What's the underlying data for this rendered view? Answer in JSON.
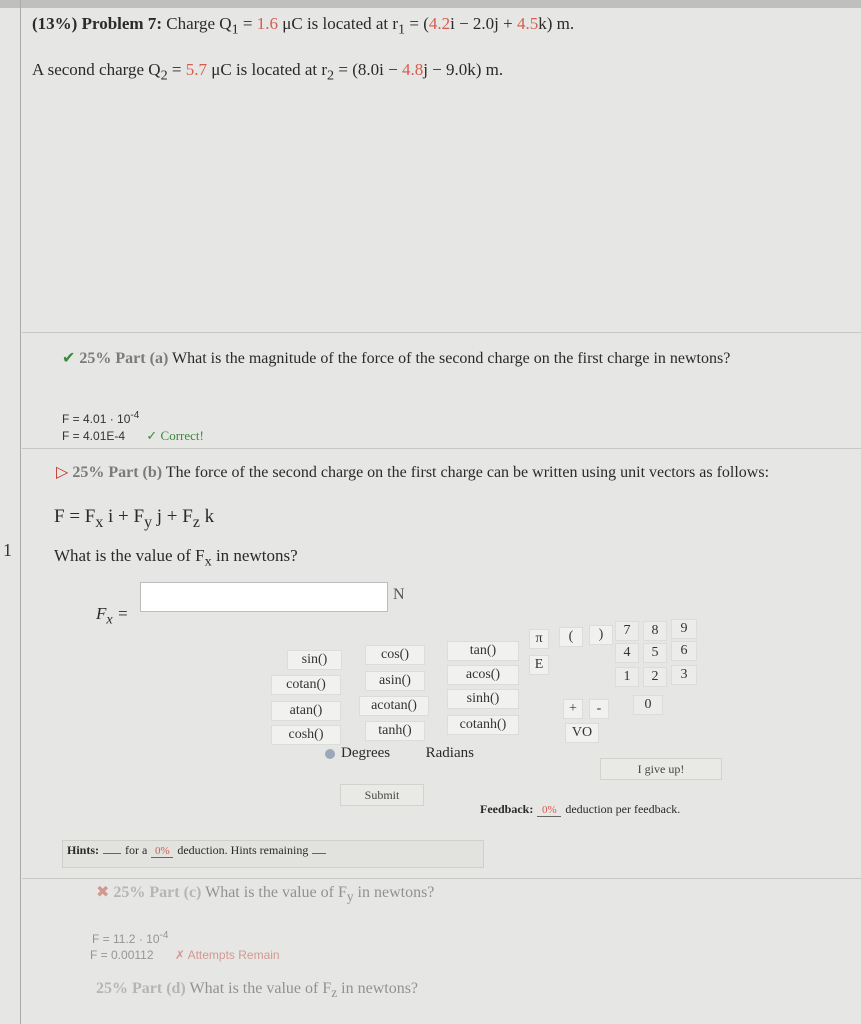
{
  "problem": {
    "weight": "(13%)",
    "title": "Problem 7:",
    "q1_text": "Charge Q",
    "q1_sub": "1",
    "q1_eq": " = ",
    "q1_value": "1.6",
    "q1_unit": " μC is located at r",
    "r1_sub": "1",
    "r1_open": " = (",
    "r1_x": "4.2",
    "r1_mid1": "i − 2.0j + ",
    "r1_z": "4.5",
    "r1_close": "k) m.",
    "q2_text": "A second charge Q",
    "q2_sub": "2",
    "q2_eq": " = ",
    "q2_value": "5.7",
    "q2_unit": " μC is located at r",
    "r2_sub": "2",
    "r2_open": " = (8.0i − ",
    "r2_y": "4.8",
    "r2_close": "j − 9.0k) m."
  },
  "part_a": {
    "tag": "25% Part (a)",
    "question": "What is the magnitude of the force of the second charge on the first charge in newtons?",
    "answer_sci_prefix": "F = 4.01 · 10",
    "answer_sci_exp": "-4",
    "answer_entered": "F = 4.01E-4",
    "status": "✓ Correct!"
  },
  "part_b": {
    "tag": "25% Part (b)",
    "question": "The force of the second charge on the first charge can be written using unit vectors as follows:",
    "formula": "F = F",
    "formula_x": "x",
    "formula_mid1": " i + F",
    "formula_y": "y",
    "formula_mid2": " j + F",
    "formula_z": "z",
    "formula_end": " k",
    "subquestion": "What is the value of F",
    "subquestion_sub": "x",
    "subquestion_end": " in newtons?",
    "input_label": "F",
    "input_label_sub": "x",
    "input_label_eq": " =",
    "input_value": "",
    "unit": "N"
  },
  "calculator": {
    "functions": [
      [
        "sin()",
        "cos()",
        "tan()"
      ],
      [
        "cotan()",
        "asin()",
        "acos()"
      ],
      [
        "atan()",
        "acotan()",
        "sinh()"
      ],
      [
        "cosh()",
        "tanh()",
        "cotanh()"
      ]
    ],
    "pi": "π",
    "open_paren": "(",
    "close_paren": ")",
    "e": "E",
    "plus": "+",
    "minus": "-",
    "numpad": [
      "7",
      "8",
      "9",
      "4",
      "5",
      "6",
      "1",
      "2",
      "3",
      "0"
    ],
    "backspace": "VO",
    "degrees": "Degrees",
    "radians": "Radians"
  },
  "actions": {
    "submit": "Submit",
    "give_up": "I give up!",
    "hints_prefix": "Hints:",
    "hints_for": "for a",
    "hints_pct": "0%",
    "hints_suffix": "deduction. Hints remaining",
    "hints_remaining": "",
    "feedback": "Feedback:",
    "feedback_pct": "0%",
    "feedback_suffix": "deduction per feedback."
  },
  "part_c": {
    "tag": "25% Part (c)",
    "question": "What is the value of F",
    "question_sub": "y",
    "question_end": " in newtons?",
    "answer_sci_prefix": "F",
    "answer_sci_body": " = 11.2 · 10",
    "answer_sci_exp": "-4",
    "answer_entered": "F = 0.00112",
    "status": "✗ Attempts Remain"
  },
  "part_d": {
    "tag": "25% Part (d)",
    "question": "What is the value of F",
    "question_sub": "z",
    "question_end": " in newtons?"
  }
}
